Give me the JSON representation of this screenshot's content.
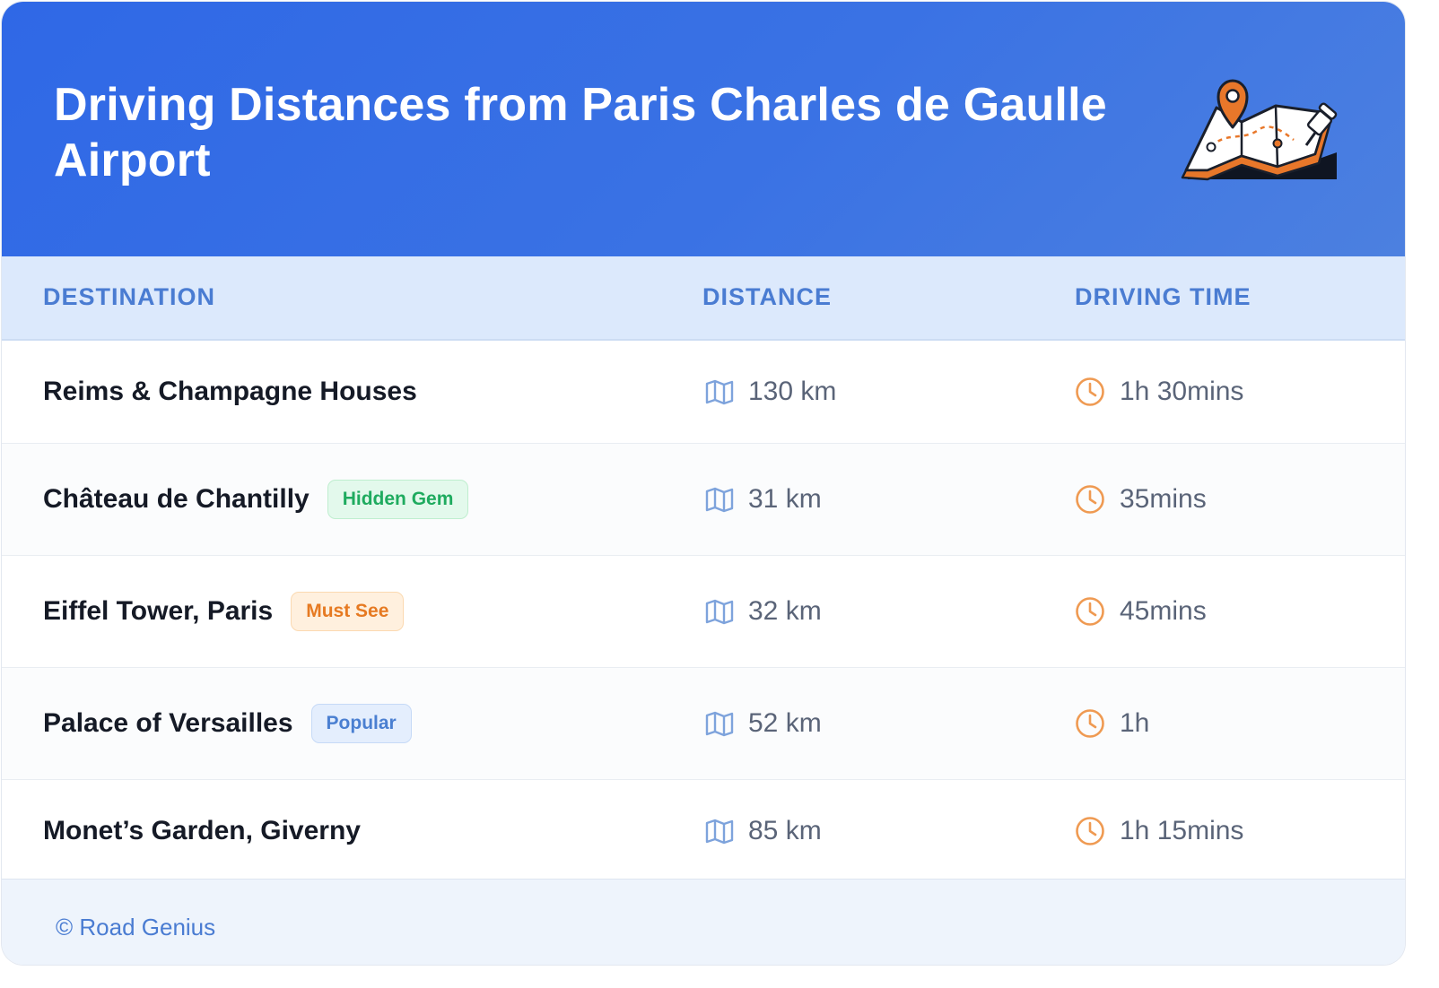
{
  "header": {
    "title": "Driving Distances from Paris Charles de Gaulle Airport",
    "illustration_icon": "map-with-pin-icon"
  },
  "table": {
    "columns": [
      "DESTINATION",
      "DISTANCE",
      "DRIVING TIME"
    ],
    "rows": [
      {
        "destination": "Reims & Champagne Houses",
        "badge": "",
        "distance": "130 km",
        "time": "1h 30mins"
      },
      {
        "destination": "Château de Chantilly",
        "badge": "Hidden Gem",
        "badge_color": "#1fab5f",
        "distance": "31 km",
        "time": "35mins"
      },
      {
        "destination": "Eiffel Tower, Paris",
        "badge": "Must See",
        "badge_color": "#e67a22",
        "distance": "32 km",
        "time": "45mins"
      },
      {
        "destination": "Palace of Versailles",
        "badge": "Popular",
        "badge_color": "#4a7fd1",
        "distance": "52 km",
        "time": "1h"
      },
      {
        "destination": "Monet’s Garden, Giverny",
        "badge": "",
        "distance": "85 km",
        "time": "1h 15mins"
      }
    ],
    "distance_icon": "map-icon",
    "time_icon": "clock-icon"
  },
  "footer": {
    "text": "© Road Genius"
  },
  "colors": {
    "header_blue": "#2f68e6",
    "accent_blue": "#4a7cd2",
    "clock_orange": "#ef9a52",
    "map_icon_blue": "#7ea3dc"
  }
}
